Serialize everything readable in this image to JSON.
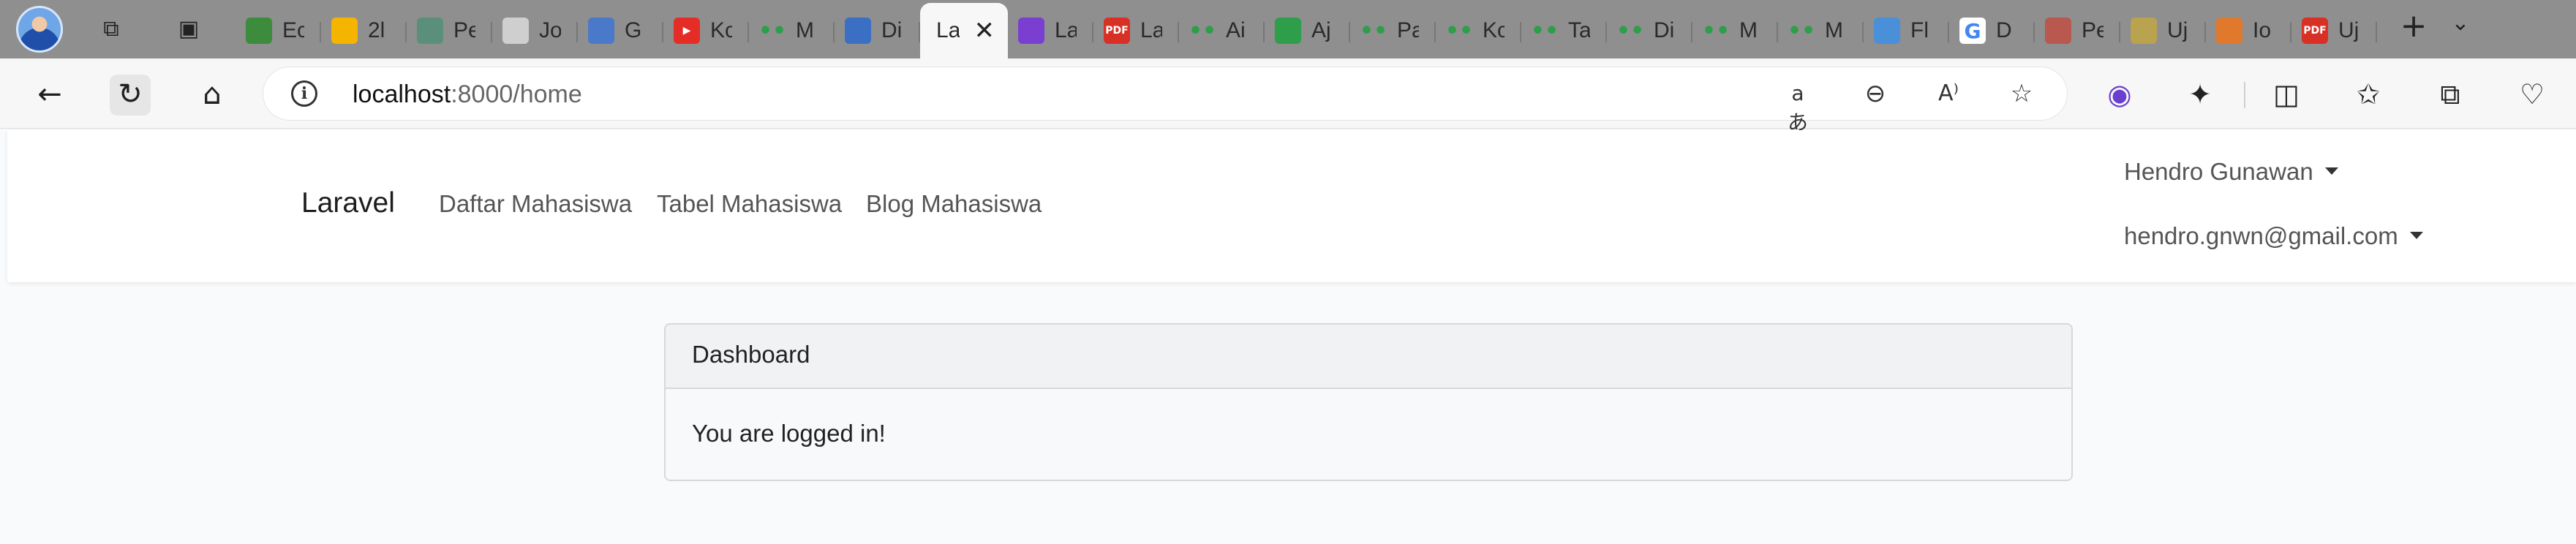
{
  "browser": {
    "tabs": [
      {
        "title": "Ec",
        "icon": "map-pin-icon",
        "color": "#3d8b3d"
      },
      {
        "title": "2l",
        "icon": "google-drive-icon",
        "color": "#f4b400"
      },
      {
        "title": "Pe",
        "icon": "openai-icon",
        "color": "#5a8f7b"
      },
      {
        "title": "Jo",
        "icon": "wikipedia-icon",
        "color": "#cfcfcf"
      },
      {
        "title": "G",
        "icon": "google-translate-icon",
        "color": "#4b79c9"
      },
      {
        "title": "Kc",
        "icon": "youtube-icon",
        "color": "#e52d27"
      },
      {
        "title": "M",
        "icon": "dots-icon",
        "color": "#2e9e4b"
      },
      {
        "title": "Di",
        "icon": "search-icon",
        "color": "#3a6fc4"
      },
      {
        "title": "La",
        "icon": "",
        "color": "#f7f7f7",
        "active": true
      },
      {
        "title": "La",
        "icon": "color-wheel-icon",
        "color": "#7a3fd0"
      },
      {
        "title": "La",
        "icon": "pdf-icon",
        "color": "#d93025"
      },
      {
        "title": "Ai",
        "icon": "dots-icon",
        "color": "#2e9e4b"
      },
      {
        "title": "Aj",
        "icon": "arc-icon",
        "color": "#2e9e4b"
      },
      {
        "title": "Pa",
        "icon": "dots-icon",
        "color": "#2e9e4b"
      },
      {
        "title": "Kc",
        "icon": "dots-icon",
        "color": "#2e9e4b"
      },
      {
        "title": "Ta",
        "icon": "dots-icon",
        "color": "#2e9e4b"
      },
      {
        "title": "Di",
        "icon": "dots-icon",
        "color": "#2e9e4b"
      },
      {
        "title": "M",
        "icon": "dots-icon",
        "color": "#2e9e4b"
      },
      {
        "title": "M",
        "icon": "dots-icon",
        "color": "#2e9e4b"
      },
      {
        "title": "Fl",
        "icon": "flutter-icon",
        "color": "#4a90d9"
      },
      {
        "title": "D",
        "icon": "google-icon",
        "color": "#ffffff"
      },
      {
        "title": "Pe",
        "icon": "document-icon",
        "color": "#b9584f"
      },
      {
        "title": "Uj",
        "icon": "puzzle-icon",
        "color": "#b9a34f"
      },
      {
        "title": "Io",
        "icon": "matlab-icon",
        "color": "#e0792b"
      },
      {
        "title": "Uj",
        "icon": "pdf-icon",
        "color": "#d93025"
      }
    ],
    "close_label": "✕",
    "new_tab_label": "+",
    "tab_menu_label": "⌄",
    "address": {
      "host": "localhost",
      "path": ":8000/home",
      "info_label": "i"
    },
    "omnibox_icons": [
      {
        "name": "translate-icon",
        "glyph": "aあ"
      },
      {
        "name": "zoom-out-icon",
        "glyph": "⊖"
      },
      {
        "name": "read-aloud-icon",
        "glyph": "A⁾"
      },
      {
        "name": "favorite-star-icon",
        "glyph": "☆"
      }
    ],
    "toolbar_icons": [
      {
        "name": "color-extension-icon",
        "glyph": "◉"
      },
      {
        "name": "extensions-puzzle-icon",
        "glyph": "✦"
      },
      {
        "name": "split-screen-icon",
        "glyph": "◫"
      },
      {
        "name": "favorites-list-icon",
        "glyph": "✩"
      },
      {
        "name": "collections-icon",
        "glyph": "⧉"
      },
      {
        "name": "browser-essentials-icon",
        "glyph": "♡"
      }
    ],
    "nav": {
      "back_glyph": "←",
      "refresh_glyph": "↻",
      "home_glyph": "⌂"
    }
  },
  "app": {
    "brand": "Laravel",
    "links": [
      "Daftar Mahasiswa",
      "Tabel Mahasiswa",
      "Blog Mahasiswa"
    ],
    "user_name": "Hendro Gunawan",
    "user_email": "hendro.gnwn@gmail.com",
    "card": {
      "title": "Dashboard",
      "message": "You are logged in!"
    }
  }
}
